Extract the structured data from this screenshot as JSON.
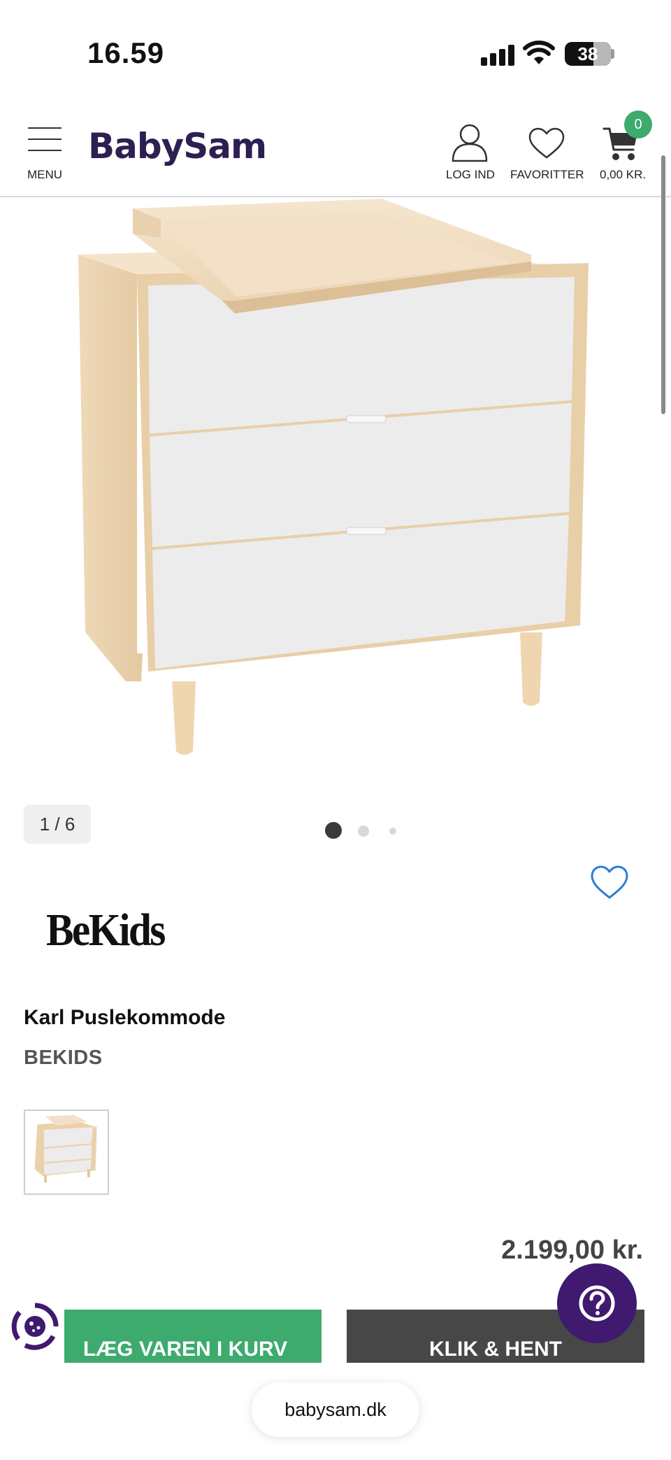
{
  "status_bar": {
    "time": "16.59",
    "battery": "38",
    "battery_level": 0.38
  },
  "header": {
    "menu_label": "MENU",
    "logo_text": "BabySam",
    "login_label": "LOG IND",
    "favorites_label": "FAVORITTER",
    "cart_total": "0,00 KR.",
    "cart_count": "0"
  },
  "gallery": {
    "counter": "1 / 6",
    "current_index": 1,
    "total": 6,
    "dots_visible": 3
  },
  "product": {
    "brand_logo_text": "BeKids",
    "title": "Karl Puslekommode",
    "brand": "BEKIDS",
    "price": "2.199,00 kr."
  },
  "actions": {
    "add_to_cart": "LÆG VAREN I KURV",
    "click_collect": "KLIK & HENT"
  },
  "browser": {
    "url": "babysam.dk"
  },
  "colors": {
    "brand_purple": "#2d1f52",
    "help_purple": "#3f1a6e",
    "cart_green": "#3daa6e",
    "pickup_gray": "#474747",
    "favorite_blue": "#2a7fd4"
  }
}
